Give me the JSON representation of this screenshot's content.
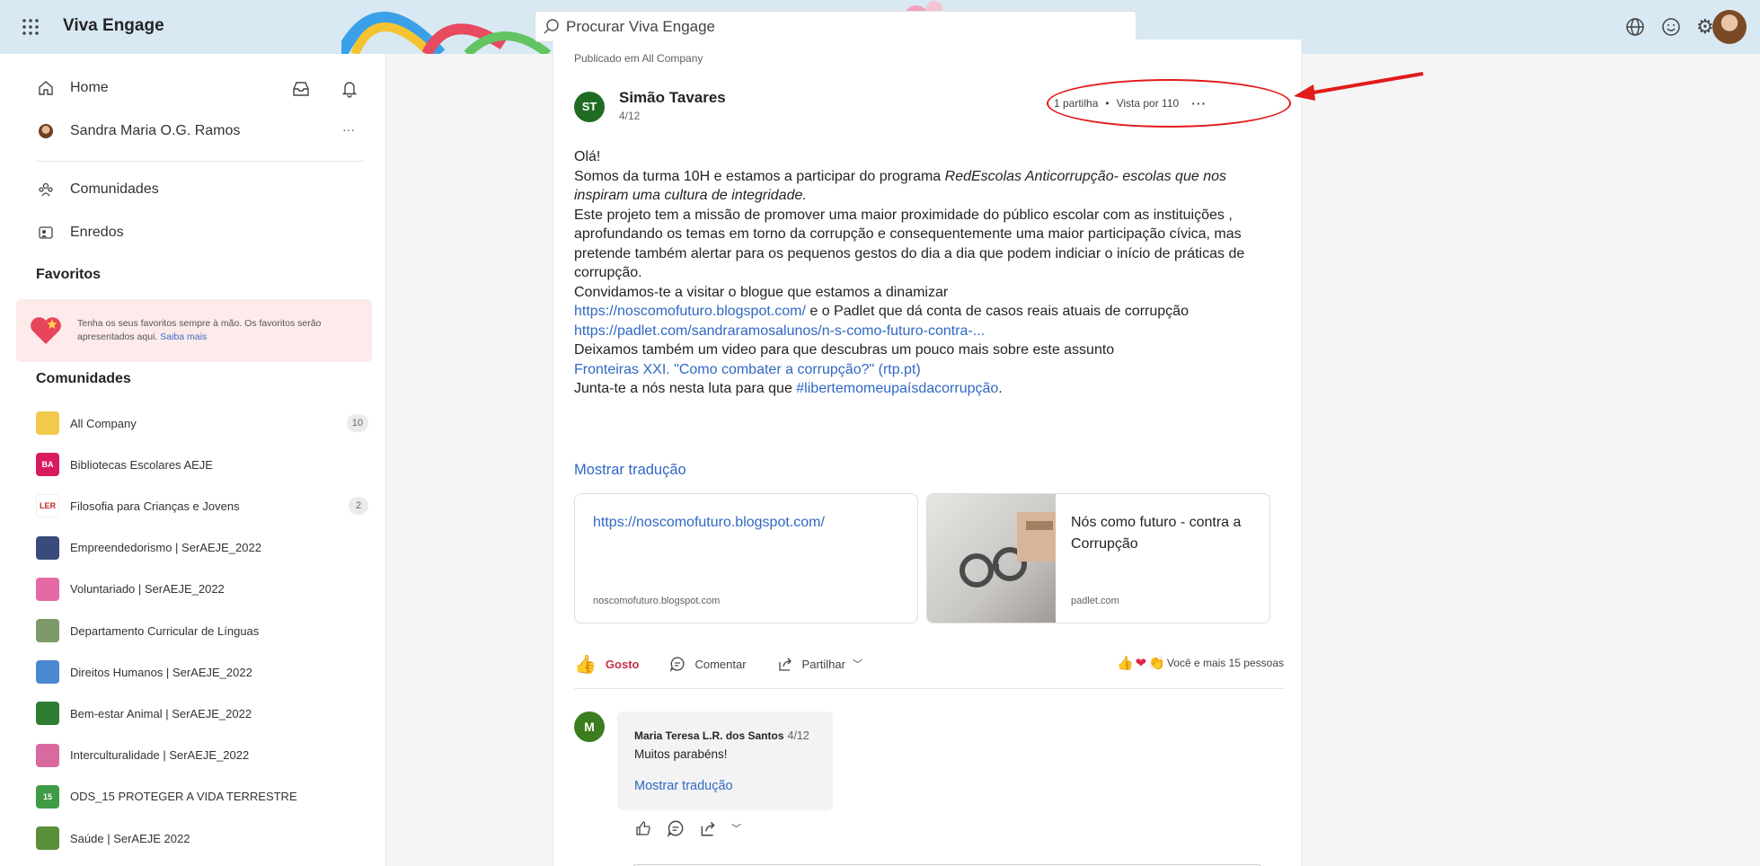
{
  "header": {
    "app_title": "Viva Engage",
    "search_placeholder": "Procurar Viva Engage"
  },
  "sidebar": {
    "home_label": "Home",
    "user_name": "Sandra Maria O.G. Ramos",
    "user_more": "···",
    "nav": [
      {
        "label": "Comunidades",
        "icon": "communities-icon"
      },
      {
        "label": "Enredos",
        "icon": "storyline-icon"
      }
    ],
    "favorites_title": "Favoritos",
    "favorites_text": "Tenha os seus favoritos sempre à mão. Os favoritos serão apresentados aqui.",
    "favorites_link": "Saiba mais",
    "communities_title": "Comunidades",
    "communities": [
      {
        "name": "All Company",
        "badge": "10",
        "avatar_text": "",
        "color": "#f2c94c"
      },
      {
        "name": "Bibliotecas Escolares AEJE",
        "badge": "",
        "avatar_text": "BA",
        "color": "#d81b60"
      },
      {
        "name": "Filosofia para Crianças e Jovens",
        "badge": "2",
        "avatar_text": "LER",
        "color": "#ffffff"
      },
      {
        "name": "Empreendedorismo | SerAEJE_2022",
        "badge": "",
        "avatar_text": "",
        "color": "#3a4a7a"
      },
      {
        "name": "Voluntariado | SerAEJE_2022",
        "badge": "",
        "avatar_text": "",
        "color": "#e36aa6"
      },
      {
        "name": "Departamento Curricular de Línguas",
        "badge": "",
        "avatar_text": "",
        "color": "#7c9a6a"
      },
      {
        "name": "Direitos Humanos | SerAEJE_2022",
        "badge": "",
        "avatar_text": "",
        "color": "#4a88d0"
      },
      {
        "name": "Bem-estar Animal | SerAEJE_2022",
        "badge": "",
        "avatar_text": "",
        "color": "#2e7d32"
      },
      {
        "name": "Interculturalidade | SerAEJE_2022",
        "badge": "",
        "avatar_text": "",
        "color": "#d96aa0"
      },
      {
        "name": "ODS_15 PROTEGER A VIDA TERRESTRE",
        "badge": "",
        "avatar_text": "15",
        "color": "#3f9b45"
      },
      {
        "name": "Saúde | SerAEJE 2022",
        "badge": "",
        "avatar_text": "",
        "color": "#5a8f3a"
      }
    ]
  },
  "post": {
    "published_in": "Publicado em All Company",
    "author_initials": "ST",
    "author_name": "Simão Tavares",
    "date": "4/12",
    "shares": "1 partilha",
    "views": "Vista por 110",
    "more": "···",
    "body": {
      "greeting": "Olá!",
      "p1_before": "Somos da turma 10H e estamos a participar do programa ",
      "p1_italic": "RedEscolas Anticorrupção- escolas que nos inspiram uma cultura de integridade.",
      "p2": "Este projeto tem a missão de promover uma maior proximidade do público escolar com as instituições , aprofundando os temas em torno da corrupção e consequentemente uma maior participação cívica, mas pretende também alertar para os pequenos gestos do dia a dia que podem indiciar o início de práticas de corrupção.",
      "p3": "Convidamos-te a visitar o blogue que estamos a dinamizar",
      "link1": "https://noscomofuturo.blogspot.com/",
      "p4_mid": " e o Padlet que dá conta de casos reais atuais de corrupção ",
      "link2": "https://padlet.com/sandraramosalunos/n-s-como-futuro-contra-...",
      "p5": "Deixamos também um video para que descubras um pouco mais sobre este assunto",
      "link3": "Fronteiras XXI. \"Como combater a corrupção?\" (rtp.pt)",
      "p6_before": "Junta-te a nós nesta luta para que ",
      "hashtag": "#libertemomeupaísdacorrupção",
      "p6_after": "."
    },
    "show_translation": "Mostrar tradução",
    "link_cards": [
      {
        "title": "https://noscomofuturo.blogspot.com/",
        "domain": "noscomofuturo.blogspot.com"
      },
      {
        "title": "Nós como futuro - contra a Corrupção",
        "domain": "padlet.com"
      }
    ],
    "actions": {
      "like": "Gosto",
      "comment": "Comentar",
      "share": "Partilhar",
      "reactions_text": "Você e mais 15 pessoas"
    }
  },
  "comment": {
    "initial": "M",
    "author": "Maria Teresa L.R. dos Santos",
    "date": "4/12",
    "text": "Muitos parabéns!",
    "show_translation": "Mostrar tradução"
  },
  "colors": {
    "accent_link": "#2f68c4",
    "like_red": "#c4314b",
    "annotation_red": "#e21b1b",
    "header_bg": "#d9e9f3"
  }
}
